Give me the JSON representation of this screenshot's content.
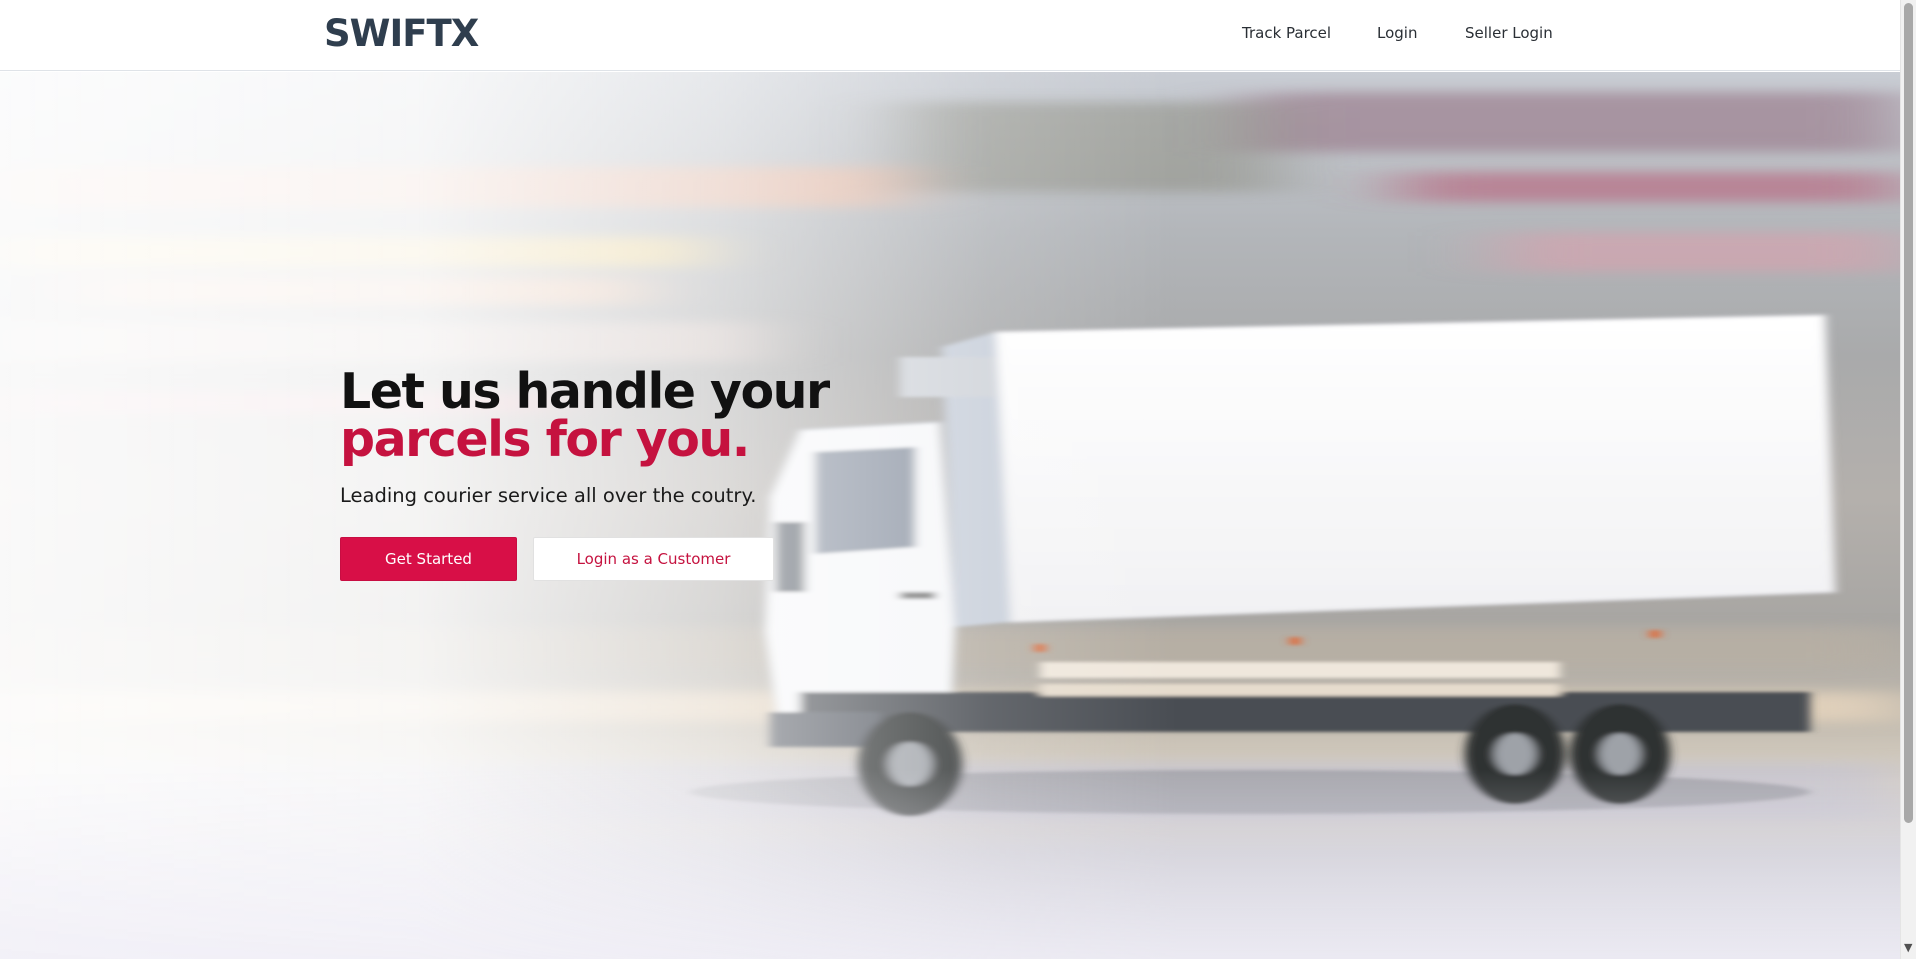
{
  "brand": {
    "logo": "SWIFTX"
  },
  "nav": {
    "items": [
      {
        "label": "Track Parcel"
      },
      {
        "label": "Login"
      },
      {
        "label": "Seller Login"
      }
    ]
  },
  "hero": {
    "headline_line1": "Let us handle your",
    "headline_line2": "parcels for you.",
    "subtitle": "Leading courier service all over the coutry.",
    "primary_button": "Get Started",
    "secondary_button": "Login as a Customer",
    "background": "motion-blurred white delivery truck"
  },
  "colors": {
    "accent": "#d80f47",
    "heading_dark": "#111111",
    "logo": "#2f3e4e"
  },
  "scrollbar": {
    "arrow_icon": "chevron-down-icon"
  }
}
